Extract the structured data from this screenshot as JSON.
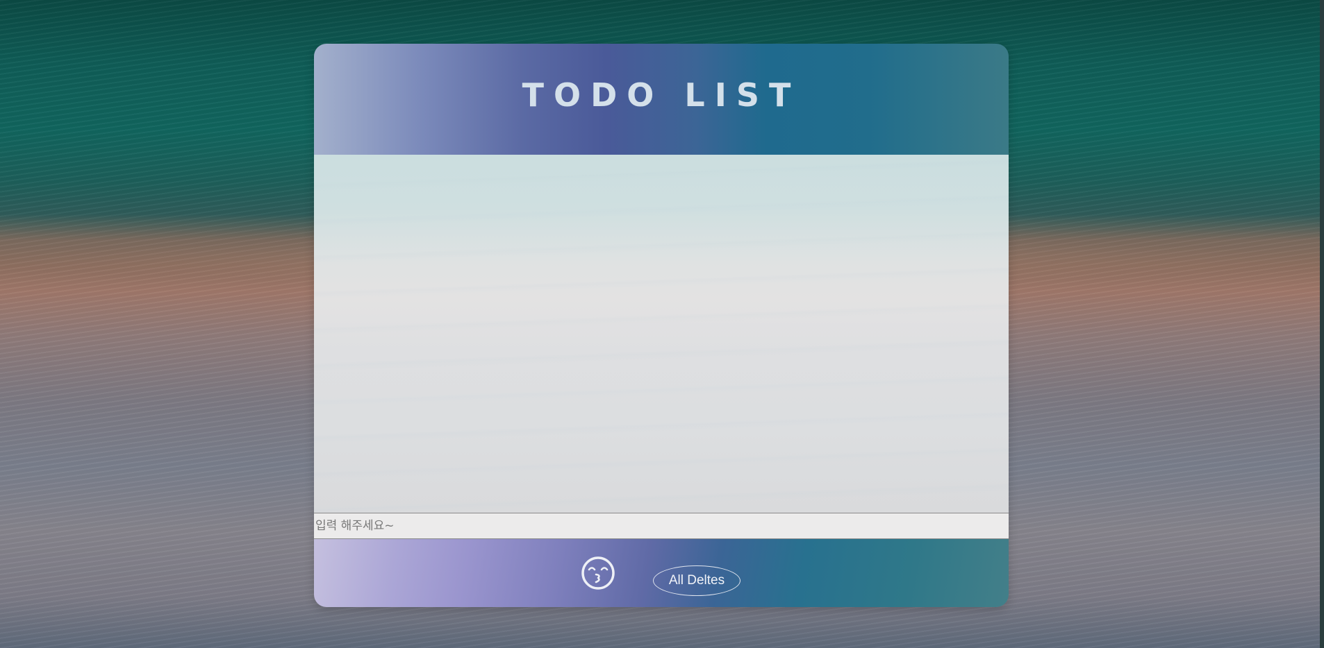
{
  "app": {
    "title": "TODO LIST"
  },
  "todo": {
    "items": [],
    "input_placeholder": "입력 해주세요~",
    "input_value": ""
  },
  "footer": {
    "emoji_icon": "kissing-face-icon",
    "all_deletes_label": "All Deltes"
  },
  "colors": {
    "title_text": "#d4e0ea",
    "footer_button_text": "#f1f3f8",
    "input_background": "#ecebeb"
  }
}
